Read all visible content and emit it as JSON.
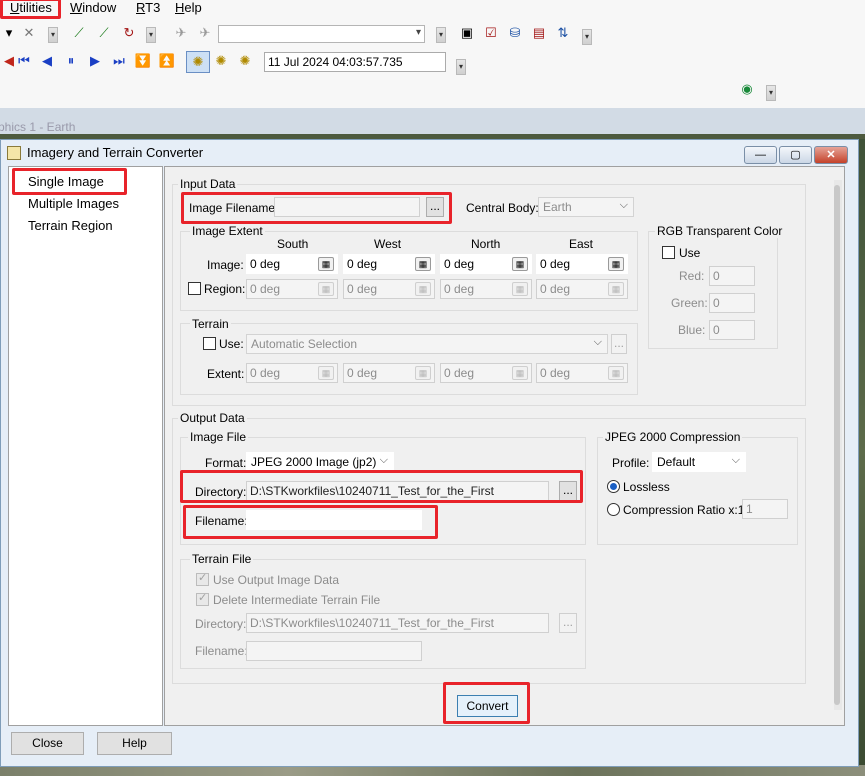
{
  "menubar": {
    "items": [
      {
        "label": "Utilities",
        "ul": "U",
        "rest": "tilities"
      },
      {
        "label": "Window",
        "ul": "W",
        "rest": "indow"
      },
      {
        "label": "RT3",
        "ul": "R",
        "rest": "T3"
      },
      {
        "label": "Help",
        "ul": "H",
        "rest": "elp"
      }
    ]
  },
  "toolbar": {
    "datetime": "11 Jul 2024 04:03:57.735"
  },
  "background_window": {
    "title": "phics 1 - Earth"
  },
  "dialog": {
    "title": "Imagery and Terrain Converter",
    "nav": [
      "Single Image",
      "Multiple Images",
      "Terrain Region"
    ],
    "input_data": {
      "group_label": "Input Data",
      "image_filename_label": "Image Filename:",
      "image_filename_value": "",
      "browse": "...",
      "central_body_label": "Central Body:",
      "central_body_value": "Earth",
      "image_extent": {
        "group_label": "Image Extent",
        "headers": [
          "South",
          "West",
          "North",
          "East"
        ],
        "image_label": "Image:",
        "image_values": [
          "0 deg",
          "0 deg",
          "0 deg",
          "0 deg"
        ],
        "region_label": "Region:",
        "region_values": [
          "0 deg",
          "0 deg",
          "0 deg",
          "0 deg"
        ]
      },
      "terrain": {
        "group_label": "Terrain",
        "use_label": "Use:",
        "use_value": "Automatic Selection",
        "extent_label": "Extent:",
        "extent_values": [
          "0 deg",
          "0 deg",
          "0 deg",
          "0 deg"
        ]
      },
      "rgb": {
        "group_label": "RGB Transparent Color",
        "use_label": "Use",
        "red_label": "Red:",
        "red_value": "0",
        "green_label": "Green:",
        "green_value": "0",
        "blue_label": "Blue:",
        "blue_value": "0"
      }
    },
    "output_data": {
      "group_label": "Output Data",
      "image_file": {
        "group_label": "Image File",
        "format_label": "Format:",
        "format_value": "JPEG 2000 Image (jp2)",
        "directory_label": "Directory:",
        "directory_value": "D:\\STKworkfiles\\10240711_Test_for_the_First",
        "filename_label": "Filename:",
        "filename_value": ""
      },
      "jpeg2000": {
        "group_label": "JPEG 2000 Compression",
        "profile_label": "Profile:",
        "profile_value": "Default",
        "lossless_label": "Lossless",
        "ratio_label": "Compression Ratio x:1",
        "ratio_value": "1"
      },
      "terrain_file": {
        "group_label": "Terrain File",
        "use_output_label": "Use Output Image Data",
        "delete_label": "Delete Intermediate Terrain File",
        "directory_label": "Directory:",
        "directory_value": "D:\\STKworkfiles\\10240711_Test_for_the_First",
        "filename_label": "Filename:",
        "filename_value": ""
      }
    },
    "convert_label": "Convert",
    "close_label": "Close",
    "help_label": "Help"
  },
  "colors": {
    "highlight": "#e8232a",
    "radio_selected": "#1a5fc4"
  }
}
